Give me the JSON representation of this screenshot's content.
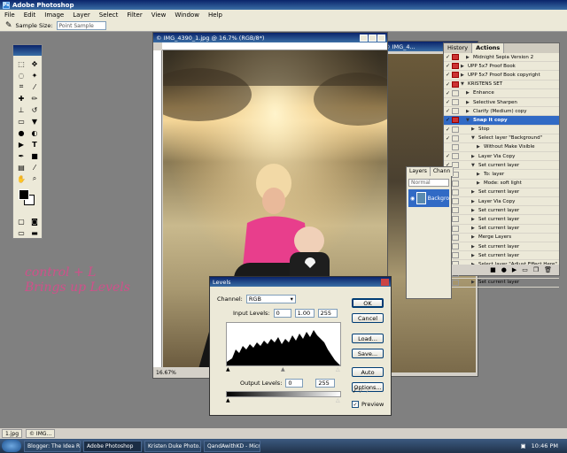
{
  "app": {
    "title": "Adobe Photoshop"
  },
  "menu": [
    "File",
    "Edit",
    "Image",
    "Layer",
    "Select",
    "Filter",
    "View",
    "Window",
    "Help"
  ],
  "options": {
    "label": "Sample Size:",
    "value": "Point Sample"
  },
  "doc_back": {
    "title": "© IMG_4..."
  },
  "doc_main": {
    "title": "© IMG_4390_1.jpg @ 16.7% (RGB/8*)",
    "zoom": "16.67%"
  },
  "handwriting": {
    "line1": "control + L",
    "line2": "Brings up Levels"
  },
  "layers": {
    "tabs": [
      "Layers",
      "Chann"
    ],
    "blend": "Normal",
    "layer_name": "Backgro"
  },
  "actions": {
    "tabs": [
      "History",
      "Actions"
    ],
    "rows": [
      {
        "label": "Midnight Sepia Version 2",
        "chk": "✓",
        "red": true,
        "open": false,
        "indent": 1
      },
      {
        "label": "UPP 5x7 Proof Book",
        "chk": "✓",
        "red": true,
        "open": false,
        "indent": 0
      },
      {
        "label": "UPP 5x7 Proof Book copyright",
        "chk": "✓",
        "red": true,
        "open": false,
        "indent": 0
      },
      {
        "label": "KRISTENS SET",
        "chk": "✓",
        "red": true,
        "open": true,
        "indent": 0
      },
      {
        "label": "Enhance",
        "chk": "✓",
        "red": false,
        "open": false,
        "indent": 1
      },
      {
        "label": "Selective Sharpen",
        "chk": "✓",
        "red": false,
        "open": false,
        "indent": 1
      },
      {
        "label": "Clarify (Medium) copy",
        "chk": "✓",
        "red": false,
        "open": false,
        "indent": 1
      },
      {
        "label": "Snap It copy",
        "chk": "✓",
        "red": true,
        "open": true,
        "indent": 1,
        "selected": true
      },
      {
        "label": "Stop",
        "chk": "✓",
        "red": false,
        "open": false,
        "indent": 2
      },
      {
        "label": "Select layer \"Background\"",
        "chk": "✓",
        "red": false,
        "open": true,
        "indent": 2
      },
      {
        "label": "Without Make Visible",
        "chk": "",
        "red": false,
        "open": false,
        "indent": 3
      },
      {
        "label": "Layer Via Copy",
        "chk": "✓",
        "red": false,
        "open": false,
        "indent": 2
      },
      {
        "label": "Set current layer",
        "chk": "✓",
        "red": false,
        "open": true,
        "indent": 2
      },
      {
        "label": "To: layer",
        "chk": "",
        "red": false,
        "open": false,
        "indent": 3
      },
      {
        "label": "Mode: soft light",
        "chk": "",
        "red": false,
        "open": false,
        "indent": 3
      },
      {
        "label": "Set current layer",
        "chk": "✓",
        "red": false,
        "open": false,
        "indent": 2
      },
      {
        "label": "Layer Via Copy",
        "chk": "✓",
        "red": false,
        "open": false,
        "indent": 2
      },
      {
        "label": "Set current layer",
        "chk": "✓",
        "red": false,
        "open": false,
        "indent": 2
      },
      {
        "label": "Set current layer",
        "chk": "✓",
        "red": false,
        "open": false,
        "indent": 2
      },
      {
        "label": "Set current layer",
        "chk": "✓",
        "red": false,
        "open": false,
        "indent": 2
      },
      {
        "label": "Merge Layers",
        "chk": "✓",
        "red": false,
        "open": false,
        "indent": 2
      },
      {
        "label": "Set current layer",
        "chk": "✓",
        "red": false,
        "open": false,
        "indent": 2
      },
      {
        "label": "Set current layer",
        "chk": "✓",
        "red": false,
        "open": false,
        "indent": 2
      },
      {
        "label": "Select layer \"Adjust Effect Here\"",
        "chk": "✓",
        "red": false,
        "open": false,
        "indent": 2
      },
      {
        "label": "Move current layer",
        "chk": "✓",
        "red": false,
        "open": false,
        "indent": 2
      },
      {
        "label": "Set current layer",
        "chk": "✓",
        "red": false,
        "open": false,
        "indent": 2
      }
    ]
  },
  "levels": {
    "title": "Levels",
    "channel_label": "Channel:",
    "channel_value": "RGB",
    "input_label": "Input Levels:",
    "input_black": "0",
    "input_gamma": "1.00",
    "input_white": "255",
    "output_label": "Output Levels:",
    "output_black": "0",
    "output_white": "255",
    "buttons": {
      "ok": "OK",
      "cancel": "Cancel",
      "load": "Load...",
      "save": "Save...",
      "auto": "Auto",
      "options": "Options..."
    },
    "preview_label": "Preview",
    "preview_checked": true
  },
  "tabstrip": [
    "1.jpg",
    "© IMG..."
  ],
  "taskbar": {
    "items": [
      "Blogger: The Idea R...",
      "Adobe Photoshop",
      "Kristen Duke Photo...",
      "QandAwithKD - Micr..."
    ],
    "active_index": 1,
    "clock": "10:46 PM"
  },
  "colors": {
    "accent": "#316ac5",
    "handwriting": "#d0508a",
    "titlebar": "#0a246a"
  }
}
